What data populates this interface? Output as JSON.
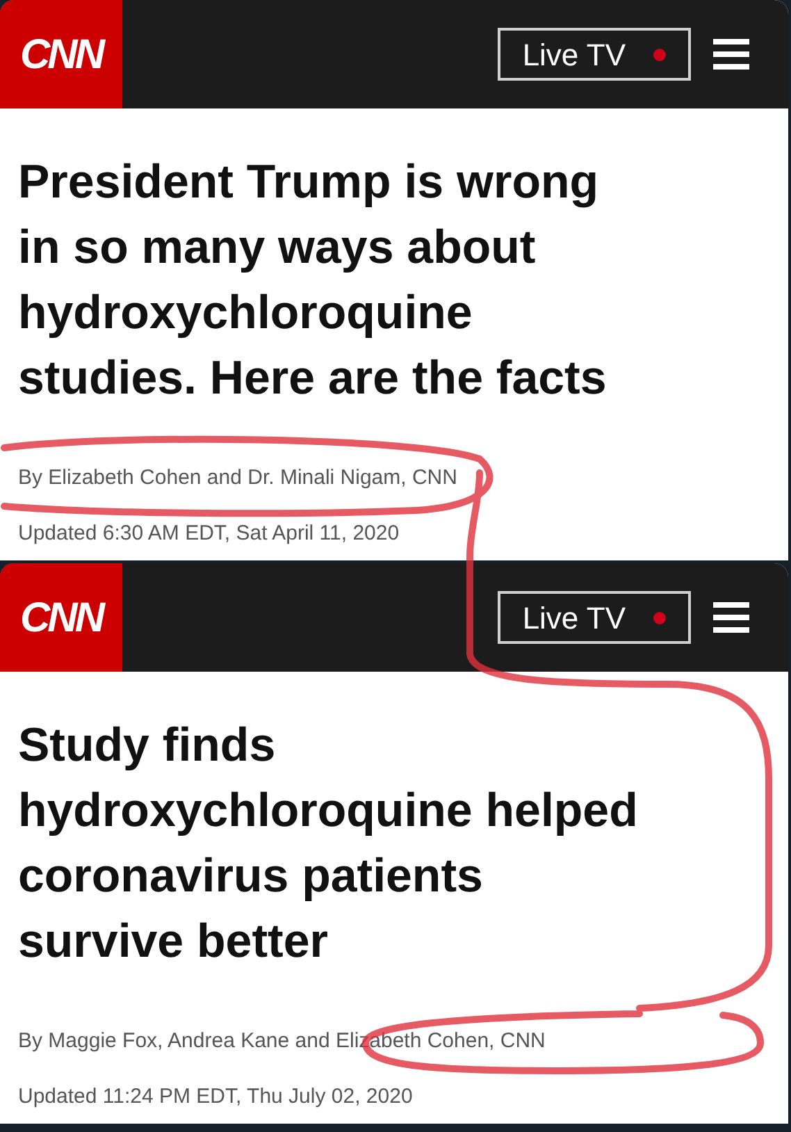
{
  "articles": [
    {
      "logo": "CNN",
      "live_button": "Live TV",
      "headline_lines": [
        "President Trump is wrong",
        "in so many ways about",
        "hydroxychloroquine",
        "studies. Here are the facts"
      ],
      "byline": "By Elizabeth Cohen and Dr. Minali Nigam, CNN",
      "updated": "Updated 6:30 AM EDT, Sat April 11, 2020"
    },
    {
      "logo": "CNN",
      "live_button": "Live TV",
      "headline_lines": [
        "Study finds",
        "hydroxychloroquine helped",
        "coronavirus patients",
        "survive better"
      ],
      "byline": "By Maggie Fox, Andrea Kane and Elizabeth Cohen, CNN",
      "updated": "Updated 11:24 PM EDT, Thu July 02, 2020"
    }
  ]
}
